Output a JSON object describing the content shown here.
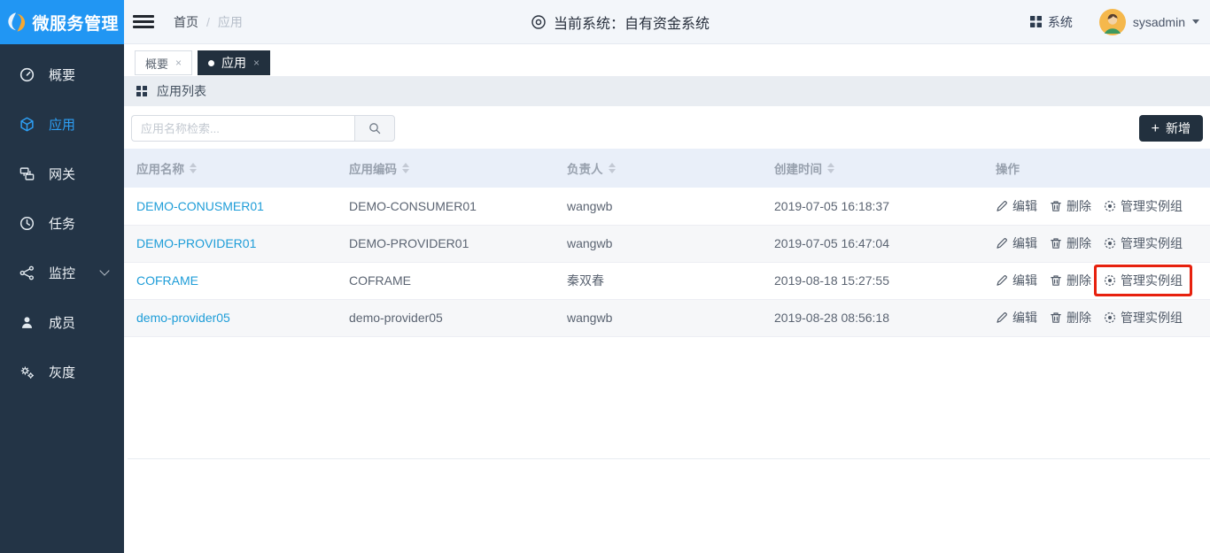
{
  "brand": {
    "title": "微服务管理"
  },
  "topbar": {
    "breadcrumb": [
      {
        "label": "首页"
      },
      {
        "label": "应用"
      }
    ],
    "current_system": "当前系统：自有资金系统",
    "system_label": "系统",
    "username": "sysadmin"
  },
  "sidebar": {
    "items": [
      {
        "label": "概要",
        "icon": "gauge-icon",
        "active": false
      },
      {
        "label": "应用",
        "icon": "cube-icon",
        "active": true
      },
      {
        "label": "网关",
        "icon": "gateway-icon",
        "active": false
      },
      {
        "label": "任务",
        "icon": "clock-icon",
        "active": false
      },
      {
        "label": "监控",
        "icon": "nodes-icon",
        "active": false,
        "has_children": true
      },
      {
        "label": "成员",
        "icon": "user-icon",
        "active": false
      },
      {
        "label": "灰度",
        "icon": "gears-icon",
        "active": false
      }
    ]
  },
  "tabs": [
    {
      "label": "概要",
      "active": false
    },
    {
      "label": "应用",
      "active": true
    }
  ],
  "panel": {
    "title": "应用列表"
  },
  "toolbar": {
    "search_placeholder": "应用名称检索...",
    "add_label": "新增"
  },
  "table": {
    "columns": [
      {
        "label": "应用名称",
        "sortable": true
      },
      {
        "label": "应用编码",
        "sortable": true
      },
      {
        "label": "负责人",
        "sortable": true
      },
      {
        "label": "创建时间",
        "sortable": true
      },
      {
        "label": "操作",
        "sortable": false
      }
    ],
    "actions": {
      "edit": "编辑",
      "delete": "删除",
      "manage": "管理实例组"
    },
    "rows": [
      {
        "name": "DEMO-CONUSMER01",
        "code": "DEMO-CONSUMER01",
        "owner": "wangwb",
        "created": "2019-07-05 16:18:37",
        "highlight_manage": false
      },
      {
        "name": "DEMO-PROVIDER01",
        "code": "DEMO-PROVIDER01",
        "owner": "wangwb",
        "created": "2019-07-05 16:47:04",
        "highlight_manage": false
      },
      {
        "name": "COFRAME",
        "code": "COFRAME",
        "owner": "秦双春",
        "created": "2019-08-18 15:27:55",
        "highlight_manage": true
      },
      {
        "name": "demo-provider05",
        "code": "demo-provider05",
        "owner": "wangwb",
        "created": "2019-08-28 08:56:18",
        "highlight_manage": false
      }
    ]
  },
  "colors": {
    "brand_blue": "#2196f3",
    "sidebar_bg": "#233446",
    "active_item_blue": "#2d9ff5",
    "link_blue": "#1e9dd8",
    "dark_navy": "#22303e",
    "table_header_bg": "#e9eff9",
    "highlight_red": "#e7210e"
  }
}
